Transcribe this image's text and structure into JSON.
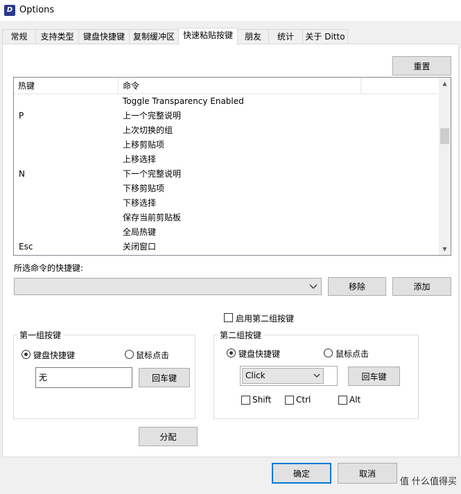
{
  "window": {
    "title": "Options",
    "app_icon": "ditto-icon"
  },
  "tabs": [
    {
      "label": "常规"
    },
    {
      "label": "支持类型"
    },
    {
      "label": "键盘快捷键"
    },
    {
      "label": "复制缓冲区"
    },
    {
      "label": "快速粘贴按键"
    },
    {
      "label": "朋友"
    },
    {
      "label": "统计"
    },
    {
      "label": "关于 Ditto"
    }
  ],
  "active_tab": "快速粘贴按键",
  "reset_button": "重置",
  "hotkey_list": {
    "columns": [
      "热键",
      "命令"
    ],
    "rows": [
      {
        "key": "",
        "command": "Toggle Transparency Enabled"
      },
      {
        "key": "P",
        "command": "上一个完整说明"
      },
      {
        "key": "",
        "command": "上次切换的组"
      },
      {
        "key": "",
        "command": "上移剪贴项"
      },
      {
        "key": "",
        "command": "上移选择"
      },
      {
        "key": "N",
        "command": "下一个完整说明"
      },
      {
        "key": "",
        "command": "下移剪贴项"
      },
      {
        "key": "",
        "command": "下移选择"
      },
      {
        "key": "",
        "command": "保存当前剪贴板"
      },
      {
        "key": "",
        "command": "全局热键"
      },
      {
        "key": "Esc",
        "command": "关闭窗口"
      }
    ]
  },
  "selected_cmd_label": "所选命令的快捷键:",
  "combo_value": "",
  "remove_button": "移除",
  "add_button": "添加",
  "enable_second_group": {
    "label": "启用第二组按键",
    "checked": false
  },
  "group1": {
    "title": "第一组按键",
    "radio_keyboard": "键盘快捷键",
    "radio_mouse": "鼠标点击",
    "selected": "keyboard",
    "key_value": "无",
    "enter_button": "回车键"
  },
  "group2": {
    "title": "第二组按键",
    "radio_keyboard": "键盘快捷键",
    "radio_mouse": "鼠标点击",
    "selected": "keyboard",
    "select_value": "Click",
    "enter_button": "回车键",
    "shift_label": "Shift",
    "ctrl_label": "Ctrl",
    "alt_label": "Alt"
  },
  "assign_button": "分配",
  "ok_button": "确定",
  "cancel_button": "取消",
  "watermark": "值 什么值得买"
}
